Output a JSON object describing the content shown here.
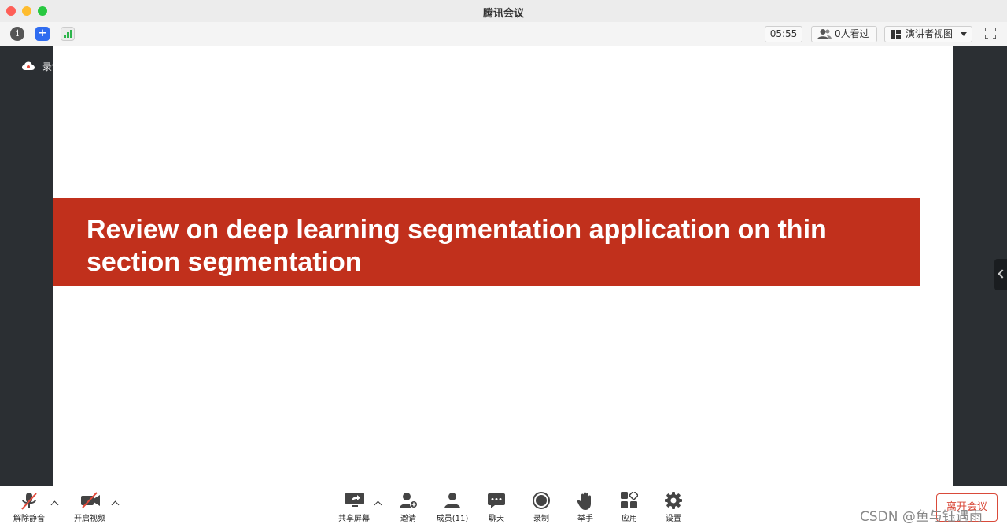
{
  "window": {
    "title": "腾讯会议"
  },
  "toolbar": {
    "timer": "05:55",
    "viewers": "0人看过",
    "layout_mode": "演讲者视图"
  },
  "recording_badge": "录制中",
  "slide": {
    "title": "Review on deep learning segmentation application on thin section segmentation",
    "banner_color": "#c1301c"
  },
  "bottom_bar": {
    "unmute": "解除静音",
    "start_video": "开启视频",
    "share_screen": "共享屏幕",
    "invite": "邀请",
    "members": "成员(11)",
    "chat": "聊天",
    "record": "录制",
    "raise_hand": "举手",
    "apps": "应用",
    "settings": "设置",
    "leave": "离开会议"
  },
  "watermark": "CSDN @鱼与钰遇雨"
}
